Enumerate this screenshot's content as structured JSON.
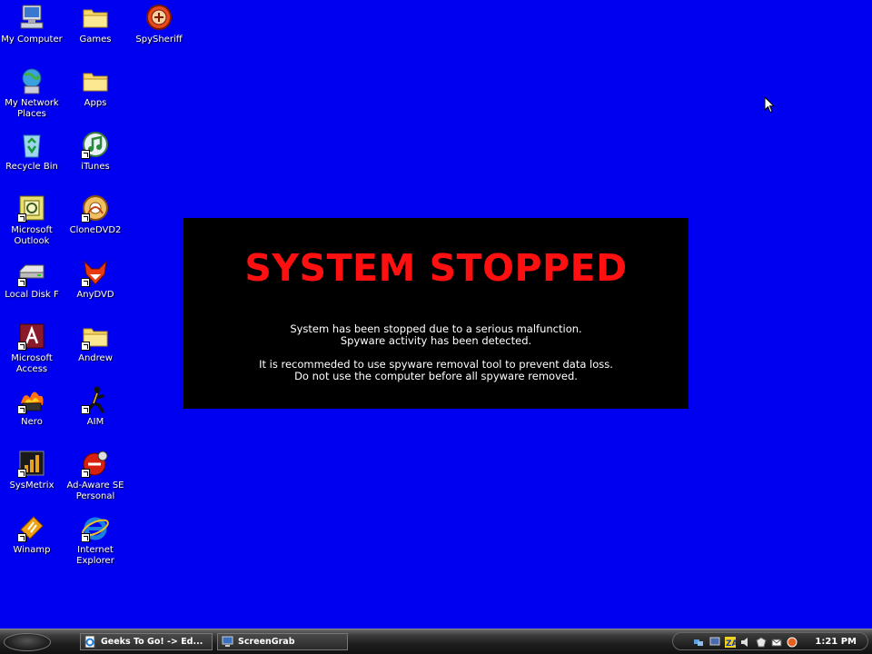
{
  "desktop": {
    "icons": [
      {
        "label": "My Computer",
        "icon": "my-computer-icon"
      },
      {
        "label": "Games",
        "icon": "folder-icon"
      },
      {
        "label": "SpySheriff",
        "icon": "spysheriff-icon"
      },
      {
        "label": "My Network\nPlaces",
        "icon": "network-places-icon"
      },
      {
        "label": "Apps",
        "icon": "folder-icon"
      },
      {
        "label": "Recycle Bin",
        "icon": "recycle-bin-icon"
      },
      {
        "label": "iTunes",
        "icon": "itunes-icon"
      },
      {
        "label": "Microsoft\nOutlook",
        "icon": "outlook-icon"
      },
      {
        "label": "CloneDVD2",
        "icon": "clonedvd-icon"
      },
      {
        "label": "Local Disk F",
        "icon": "local-disk-icon"
      },
      {
        "label": "AnyDVD",
        "icon": "anydvd-icon"
      },
      {
        "label": "Microsoft\nAccess",
        "icon": "access-icon"
      },
      {
        "label": "Andrew",
        "icon": "folder-icon"
      },
      {
        "label": "Nero",
        "icon": "nero-icon"
      },
      {
        "label": "AIM",
        "icon": "aim-icon"
      },
      {
        "label": "SysMetrix",
        "icon": "sysmetrix-icon"
      },
      {
        "label": "Ad-Aware SE\nPersonal",
        "icon": "adaware-icon"
      },
      {
        "label": "Winamp",
        "icon": "winamp-icon"
      },
      {
        "label": "Internet\nExplorer",
        "icon": "internet-explorer-icon"
      }
    ]
  },
  "alert": {
    "title": "SYSTEM STOPPED",
    "line1": "System has been stopped due to a serious malfunction.",
    "line2": "Spyware activity has been detected.",
    "line3": "It is recommeded to use spyware removal tool to prevent data loss.",
    "line4": "Do not use the computer before all spyware removed."
  },
  "taskbar": {
    "buttons": [
      {
        "label": "Geeks To Go! -> Ed...",
        "icon": "ie-page-icon"
      },
      {
        "label": "ScreenGrab",
        "icon": "screengrab-icon"
      }
    ],
    "tray_icons": [
      "network-icon",
      "monitor-icon",
      "zonealarm-icon",
      "speaker-icon",
      "security-icon",
      "mail-icon",
      "antivirus-icon"
    ],
    "clock": "1:21 PM"
  },
  "colors": {
    "desktop_background": "#0000f0",
    "alert_background": "#000000",
    "alert_title": "#ff1010"
  }
}
